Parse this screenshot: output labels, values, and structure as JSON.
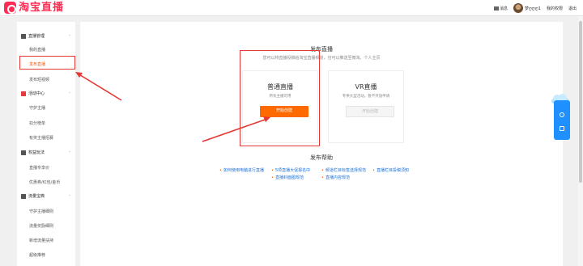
{
  "header": {
    "logo_text": "淘宝直播",
    "messages": "消息",
    "username": "梦ღღღ1",
    "my_permissions": "我的权限",
    "logout": "退出"
  },
  "sidebar": {
    "groups": [
      {
        "label": "直播管理",
        "items": [
          "我的直播",
          "发布直播",
          "发布短视频"
        ]
      },
      {
        "label": "活动中心",
        "items": [
          "守护主播",
          "扣分榜单",
          "有奖主播招募"
        ]
      },
      {
        "label": "权益玩法",
        "items": [
          "直播专享价",
          "优惠券/红包/金币"
        ]
      },
      {
        "label": "流量宝典",
        "items": [
          "守护主播细则",
          "流量奖励细则",
          "新增流量扶持",
          "超级推荐"
        ]
      }
    ]
  },
  "main": {
    "publish": {
      "title": "发布直播",
      "subtitle": "您可以将直播投稿给淘宝直播频道，也可以推送至微淘、个人主页"
    },
    "cards": [
      {
        "title": "普通直播",
        "desc": "所有主播可用",
        "button": "开始创建"
      },
      {
        "title": "VR直播",
        "desc": "专供大型活动，暂不开放申请",
        "button": "开始创建"
      }
    ],
    "help": {
      "title": "发布帮助",
      "links": [
        "如何使用电脑进行直播",
        "5项直播大促报名中",
        "频道栏目标签选择规范",
        "直播栏目投稿须知",
        "直播封面图规范",
        "直播内容规范"
      ]
    }
  },
  "colors": {
    "brand": "#ff2d55",
    "accent": "#ff6a00",
    "link": "#1a6fd6",
    "annotation": "#e53935"
  }
}
